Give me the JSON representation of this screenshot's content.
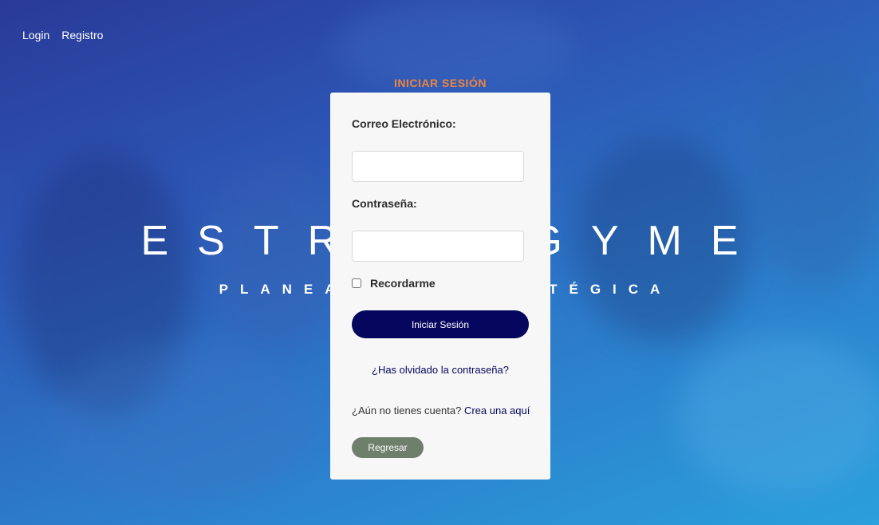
{
  "nav": {
    "login": "Login",
    "register": "Registro"
  },
  "brand": {
    "title": "ESTRATEGYME",
    "subtitle": "PLANEACIÓN ESTRATÉGICA"
  },
  "login_form": {
    "heading": "INICIAR SESIÓN",
    "email_label": "Correo Electrónico:",
    "email_value": "",
    "password_label": "Contraseña:",
    "password_value": "",
    "remember_label": "Recordarme",
    "remember_checked": false,
    "submit_label": "Iniciar Sesión",
    "forgot_link": "¿Has olvidado la contraseña?",
    "no_account_text": "¿Aún no tienes cuenta?",
    "signup_link": "Crea una aquí",
    "back_label": "Regresar"
  },
  "colors": {
    "heading_accent": "#f0843a",
    "primary_button": "#06065e",
    "secondary_button": "#6e7f6c",
    "card_background": "#f7f7f7"
  }
}
